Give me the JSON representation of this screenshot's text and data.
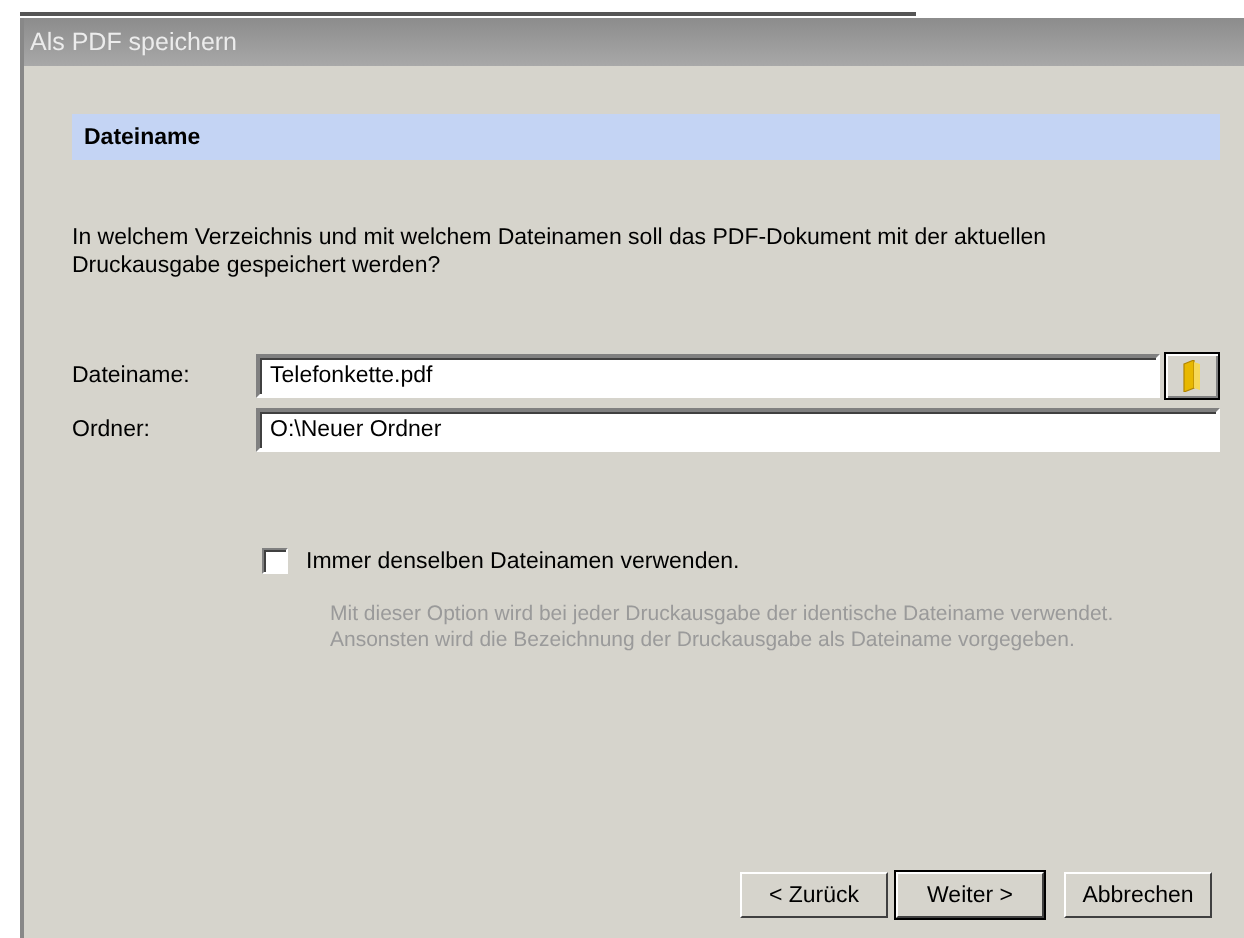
{
  "window": {
    "title": "Als PDF speichern"
  },
  "section": {
    "heading": "Dateiname"
  },
  "intro": "In welchem Verzeichnis und mit welchem Dateinamen soll das PDF-Dokument mit der aktuellen Druckausgabe gespeichert werden?",
  "fields": [
    {
      "label": "Dateiname:",
      "value": "Telefonkette.pdf",
      "browse": true
    },
    {
      "label": "Ordner:",
      "value": "O:\\Neuer Ordner",
      "browse": false
    }
  ],
  "option": {
    "label": "Immer denselben Dateinamen verwenden.",
    "checked": false,
    "hint": "Mit dieser Option wird bei jeder Druckausgabe der identische Dateiname verwendet. Ansonsten wird die Bezeichnung der Druckausgabe als Dateiname vorgegeben."
  },
  "buttons": [
    {
      "label": "< Zurück",
      "default": false
    },
    {
      "label": "Weiter >",
      "default": true
    },
    {
      "label": "Abbrechen",
      "default": false
    }
  ]
}
